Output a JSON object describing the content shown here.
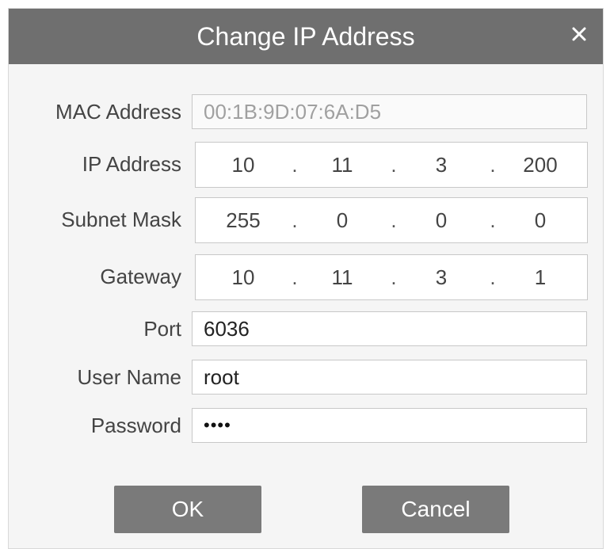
{
  "dialog": {
    "title": "Change IP Address",
    "close_icon": "close-icon"
  },
  "fields": {
    "mac": {
      "label": "MAC Address",
      "value": "00:1B:9D:07:6A:D5"
    },
    "ip": {
      "label": "IP Address",
      "octets": [
        "10",
        "11",
        "3",
        "200"
      ]
    },
    "subnet": {
      "label": "Subnet Mask",
      "octets": [
        "255",
        "0",
        "0",
        "0"
      ]
    },
    "gateway": {
      "label": "Gateway",
      "octets": [
        "10",
        "11",
        "3",
        "1"
      ]
    },
    "port": {
      "label": "Port",
      "value": "6036"
    },
    "username": {
      "label": "User Name",
      "value": "root"
    },
    "password": {
      "label": "Password",
      "value": "••••"
    }
  },
  "buttons": {
    "ok": "OK",
    "cancel": "Cancel"
  },
  "ip_separator": "."
}
